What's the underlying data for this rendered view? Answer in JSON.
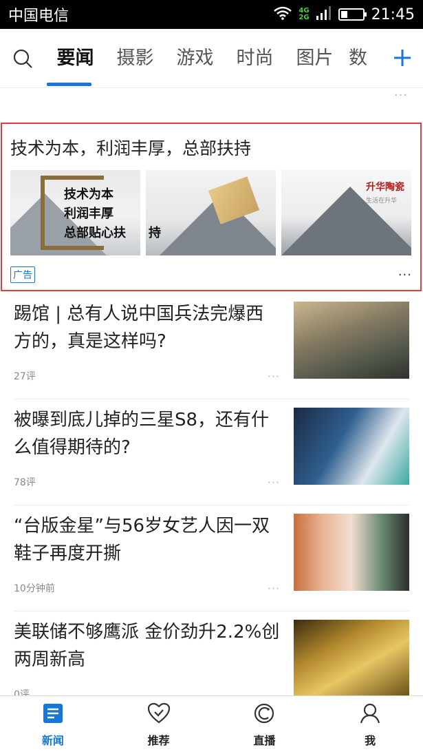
{
  "status_bar": {
    "carrier": "中国电信",
    "network_top": "4G",
    "network_bottom": "2G",
    "time": "21:45"
  },
  "tabs": [
    {
      "label": "要闻",
      "active": true
    },
    {
      "label": "摄影",
      "active": false
    },
    {
      "label": "游戏",
      "active": false
    },
    {
      "label": "时尚",
      "active": false
    },
    {
      "label": "图片",
      "active": false
    },
    {
      "label": "数",
      "active": false
    }
  ],
  "ad": {
    "title": "技术为本，利润丰厚，总部扶持",
    "slogan": [
      "技术为本",
      "利润丰厚",
      "总部贴心扶"
    ],
    "slogan_end": "持",
    "logo": "升华陶瓷",
    "logo_sub": "生活在升华",
    "badge": "广告",
    "more": "···"
  },
  "news": [
    {
      "title": "踢馆 | 总有人说中国兵法完爆西方的，真是这样吗?",
      "meta": "27评"
    },
    {
      "title": "被曝到底儿掉的三星S8，还有什么值得期待的?",
      "meta": "78评"
    },
    {
      "title": "“台版金星”与56岁女艺人因一双鞋子再度开撕",
      "meta": "10分钟前"
    },
    {
      "title": "美联储不够鹰派 金价劲升2.2%创两周新高",
      "meta": "0评"
    }
  ],
  "bottom_nav": [
    {
      "label": "新闻",
      "icon": "news-icon",
      "active": true
    },
    {
      "label": "推荐",
      "icon": "heart-check-icon",
      "active": false
    },
    {
      "label": "直播",
      "icon": "live-icon",
      "active": false
    },
    {
      "label": "我",
      "icon": "person-icon",
      "active": false
    }
  ],
  "colors": {
    "accent": "#1677d8",
    "ad_border": "#e23b3b"
  }
}
